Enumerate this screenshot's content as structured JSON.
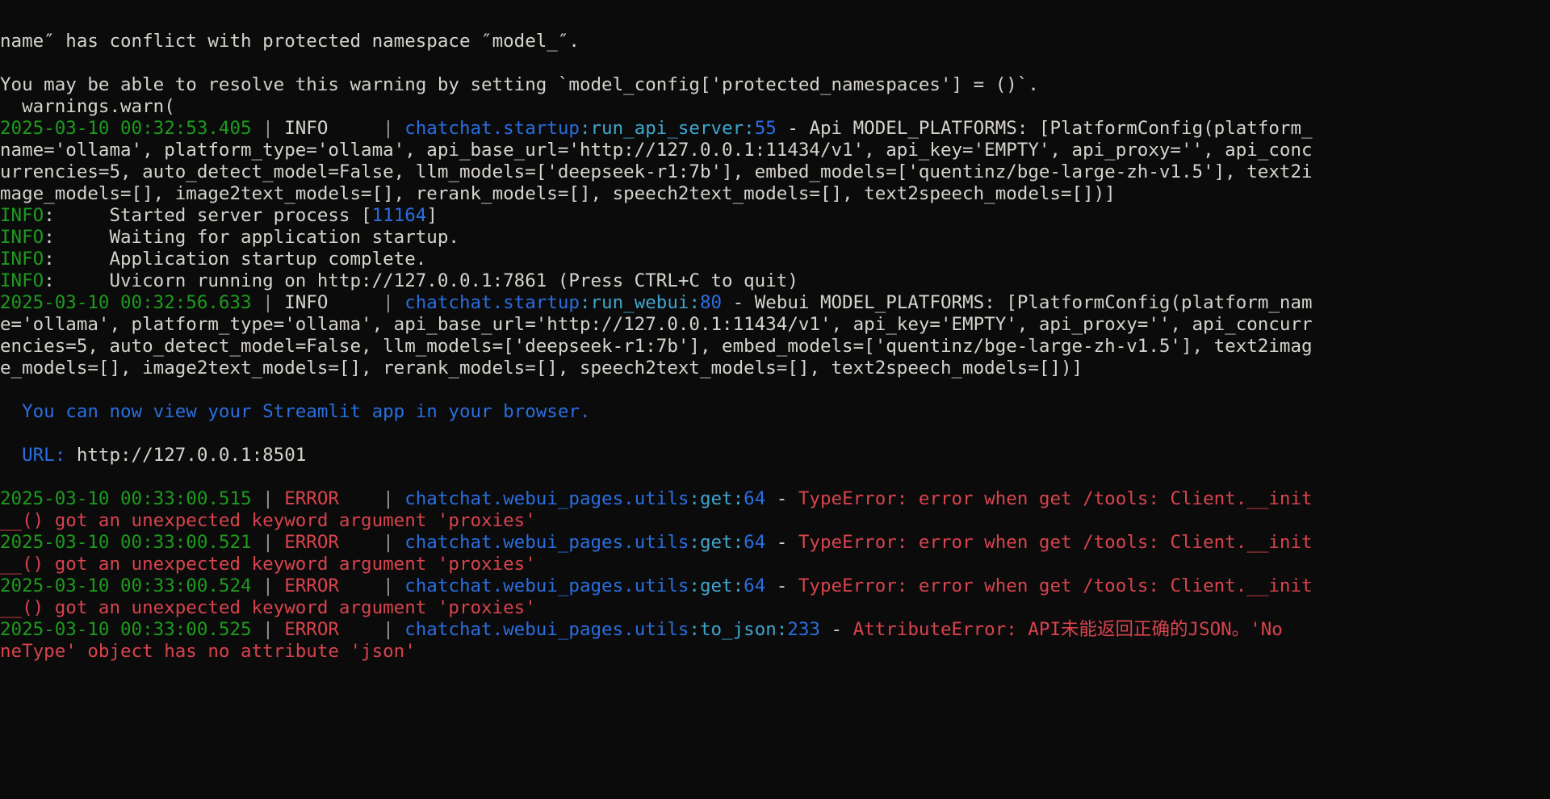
{
  "terminal": {
    "window_kind": "console-log-output",
    "background_color": "#0b0b0b",
    "palette": {
      "white": "#d6d3cd",
      "green": "#1d9b1d",
      "blue": "#2a6ee0",
      "cyan": "#3fa6cf",
      "red": "#d9434d",
      "separator": "#9a958c"
    },
    "lines": [
      {
        "id": "l01",
        "name": "warning-conflict-line",
        "segments": [
          {
            "text": "name″ has conflict with protected namespace ″model_″.",
            "color": "white"
          }
        ]
      },
      {
        "id": "l02",
        "name": "blank-line",
        "segments": []
      },
      {
        "id": "l03",
        "name": "warning-resolve-hint-line",
        "segments": [
          {
            "text": "You may be able to resolve this warning by setting `model_config['protected_namespaces'] = ()`.",
            "color": "white"
          }
        ]
      },
      {
        "id": "l04",
        "name": "warnings-warn-line",
        "segments": [
          {
            "text": "  warnings.warn(",
            "color": "white"
          }
        ]
      },
      {
        "id": "l05",
        "name": "log-line-api-model-platforms",
        "segments": [
          {
            "text": "2025-03-10 00:32:53.405",
            "color": "green"
          },
          {
            "text": " | ",
            "color": "separator"
          },
          {
            "text": "INFO    ",
            "color": "white"
          },
          {
            "text": " | ",
            "color": "separator"
          },
          {
            "text": "chatchat.startup",
            "color": "blue"
          },
          {
            "text": ":",
            "color": "cyan"
          },
          {
            "text": "run_api_server",
            "color": "cyan"
          },
          {
            "text": ":",
            "color": "cyan"
          },
          {
            "text": "55",
            "color": "blue"
          },
          {
            "text": " - ",
            "color": "white"
          },
          {
            "text": "Api MODEL_PLATFORMS: [PlatformConfig(platform_",
            "color": "white"
          }
        ]
      },
      {
        "id": "l06",
        "name": "log-wrap-api-1",
        "segments": [
          {
            "text": "name='ollama', platform_type='ollama', api_base_url='http://127.0.0.1:11434/v1', api_key='EMPTY', api_proxy='', api_conc",
            "color": "white"
          }
        ]
      },
      {
        "id": "l07",
        "name": "log-wrap-api-2",
        "segments": [
          {
            "text": "urrencies=5, auto_detect_model=False, llm_models=['deepseek-r1:7b'], embed_models=['quentinz/bge-large-zh-v1.5'], text2i",
            "color": "white"
          }
        ]
      },
      {
        "id": "l08",
        "name": "log-wrap-api-3",
        "segments": [
          {
            "text": "mage_models=[], image2text_models=[], rerank_models=[], speech2text_models=[], text2speech_models=[])]",
            "color": "white"
          }
        ]
      },
      {
        "id": "l09",
        "name": "uvicorn-started-server-process",
        "segments": [
          {
            "text": "INFO",
            "color": "green"
          },
          {
            "text": ":     Started server process [",
            "color": "white"
          },
          {
            "text": "11164",
            "color": "blue"
          },
          {
            "text": "]",
            "color": "white"
          }
        ]
      },
      {
        "id": "l10",
        "name": "uvicorn-waiting-startup",
        "segments": [
          {
            "text": "INFO",
            "color": "green"
          },
          {
            "text": ":     Waiting for application startup.",
            "color": "white"
          }
        ]
      },
      {
        "id": "l11",
        "name": "uvicorn-startup-complete",
        "segments": [
          {
            "text": "INFO",
            "color": "green"
          },
          {
            "text": ":     Application startup complete.",
            "color": "white"
          }
        ]
      },
      {
        "id": "l12",
        "name": "uvicorn-running-on",
        "segments": [
          {
            "text": "INFO",
            "color": "green"
          },
          {
            "text": ":     Uvicorn running on http://127.0.0.1:7861 (Press CTRL+C to quit)",
            "color": "white"
          }
        ]
      },
      {
        "id": "l13",
        "name": "log-line-webui-model-platforms",
        "segments": [
          {
            "text": "2025-03-10 00:32:56.633",
            "color": "green"
          },
          {
            "text": " | ",
            "color": "separator"
          },
          {
            "text": "INFO    ",
            "color": "white"
          },
          {
            "text": " | ",
            "color": "separator"
          },
          {
            "text": "chatchat.startup",
            "color": "blue"
          },
          {
            "text": ":",
            "color": "cyan"
          },
          {
            "text": "run_webui",
            "color": "cyan"
          },
          {
            "text": ":",
            "color": "cyan"
          },
          {
            "text": "80",
            "color": "blue"
          },
          {
            "text": " - ",
            "color": "white"
          },
          {
            "text": "Webui MODEL_PLATFORMS: [PlatformConfig(platform_nam",
            "color": "white"
          }
        ]
      },
      {
        "id": "l14",
        "name": "log-wrap-webui-1",
        "segments": [
          {
            "text": "e='ollama', platform_type='ollama', api_base_url='http://127.0.0.1:11434/v1', api_key='EMPTY', api_proxy='', api_concurr",
            "color": "white"
          }
        ]
      },
      {
        "id": "l15",
        "name": "log-wrap-webui-2",
        "segments": [
          {
            "text": "encies=5, auto_detect_model=False, llm_models=['deepseek-r1:7b'], embed_models=['quentinz/bge-large-zh-v1.5'], text2imag",
            "color": "white"
          }
        ]
      },
      {
        "id": "l16",
        "name": "log-wrap-webui-3",
        "segments": [
          {
            "text": "e_models=[], image2text_models=[], rerank_models=[], speech2text_models=[], text2speech_models=[])]",
            "color": "white"
          }
        ]
      },
      {
        "id": "l17",
        "name": "blank-line",
        "segments": []
      },
      {
        "id": "l18",
        "name": "streamlit-view-app-line",
        "segments": [
          {
            "text": "  You can now view your Streamlit app in your browser.",
            "color": "blue"
          }
        ]
      },
      {
        "id": "l19",
        "name": "blank-line",
        "segments": []
      },
      {
        "id": "l20",
        "name": "streamlit-url-line",
        "segments": [
          {
            "text": "  URL: ",
            "color": "blue"
          },
          {
            "text": "http://127.0.0.1:8501",
            "color": "white"
          }
        ]
      },
      {
        "id": "l21",
        "name": "blank-line",
        "segments": []
      },
      {
        "id": "l22",
        "name": "error-line-tools-1",
        "segments": [
          {
            "text": "2025-03-10 00:33:00.515",
            "color": "green"
          },
          {
            "text": " | ",
            "color": "separator"
          },
          {
            "text": "ERROR   ",
            "color": "red"
          },
          {
            "text": " | ",
            "color": "separator"
          },
          {
            "text": "chatchat.webui_pages.utils",
            "color": "blue"
          },
          {
            "text": ":",
            "color": "cyan"
          },
          {
            "text": "get",
            "color": "cyan"
          },
          {
            "text": ":",
            "color": "cyan"
          },
          {
            "text": "64",
            "color": "blue"
          },
          {
            "text": " - ",
            "color": "white"
          },
          {
            "text": "TypeError: error when get /tools: Client.__init",
            "color": "red"
          }
        ]
      },
      {
        "id": "l23",
        "name": "error-wrap-tools-1",
        "segments": [
          {
            "text": "__() got an unexpected keyword argument 'proxies'",
            "color": "red"
          }
        ]
      },
      {
        "id": "l24",
        "name": "error-line-tools-2",
        "segments": [
          {
            "text": "2025-03-10 00:33:00.521",
            "color": "green"
          },
          {
            "text": " | ",
            "color": "separator"
          },
          {
            "text": "ERROR   ",
            "color": "red"
          },
          {
            "text": " | ",
            "color": "separator"
          },
          {
            "text": "chatchat.webui_pages.utils",
            "color": "blue"
          },
          {
            "text": ":",
            "color": "cyan"
          },
          {
            "text": "get",
            "color": "cyan"
          },
          {
            "text": ":",
            "color": "cyan"
          },
          {
            "text": "64",
            "color": "blue"
          },
          {
            "text": " - ",
            "color": "white"
          },
          {
            "text": "TypeError: error when get /tools: Client.__init",
            "color": "red"
          }
        ]
      },
      {
        "id": "l25",
        "name": "error-wrap-tools-2",
        "segments": [
          {
            "text": "__() got an unexpected keyword argument 'proxies'",
            "color": "red"
          }
        ]
      },
      {
        "id": "l26",
        "name": "error-line-tools-3",
        "segments": [
          {
            "text": "2025-03-10 00:33:00.524",
            "color": "green"
          },
          {
            "text": " | ",
            "color": "separator"
          },
          {
            "text": "ERROR   ",
            "color": "red"
          },
          {
            "text": " | ",
            "color": "separator"
          },
          {
            "text": "chatchat.webui_pages.utils",
            "color": "blue"
          },
          {
            "text": ":",
            "color": "cyan"
          },
          {
            "text": "get",
            "color": "cyan"
          },
          {
            "text": ":",
            "color": "cyan"
          },
          {
            "text": "64",
            "color": "blue"
          },
          {
            "text": " - ",
            "color": "white"
          },
          {
            "text": "TypeError: error when get /tools: Client.__init",
            "color": "red"
          }
        ]
      },
      {
        "id": "l27",
        "name": "error-wrap-tools-3",
        "segments": [
          {
            "text": "__() got an unexpected keyword argument 'proxies'",
            "color": "red"
          }
        ]
      },
      {
        "id": "l28",
        "name": "error-line-to-json",
        "segments": [
          {
            "text": "2025-03-10 00:33:00.525",
            "color": "green"
          },
          {
            "text": " | ",
            "color": "separator"
          },
          {
            "text": "ERROR   ",
            "color": "red"
          },
          {
            "text": " | ",
            "color": "separator"
          },
          {
            "text": "chatchat.webui_pages.utils",
            "color": "blue"
          },
          {
            "text": ":",
            "color": "cyan"
          },
          {
            "text": "to_json",
            "color": "cyan"
          },
          {
            "text": ":",
            "color": "cyan"
          },
          {
            "text": "233",
            "color": "blue"
          },
          {
            "text": " - ",
            "color": "white"
          },
          {
            "text": "AttributeError: API未能返回正确的JSON。'No",
            "color": "red"
          }
        ]
      },
      {
        "id": "l29",
        "name": "error-wrap-to-json",
        "segments": [
          {
            "text": "neType' object has no attribute 'json'",
            "color": "red"
          }
        ]
      }
    ]
  }
}
